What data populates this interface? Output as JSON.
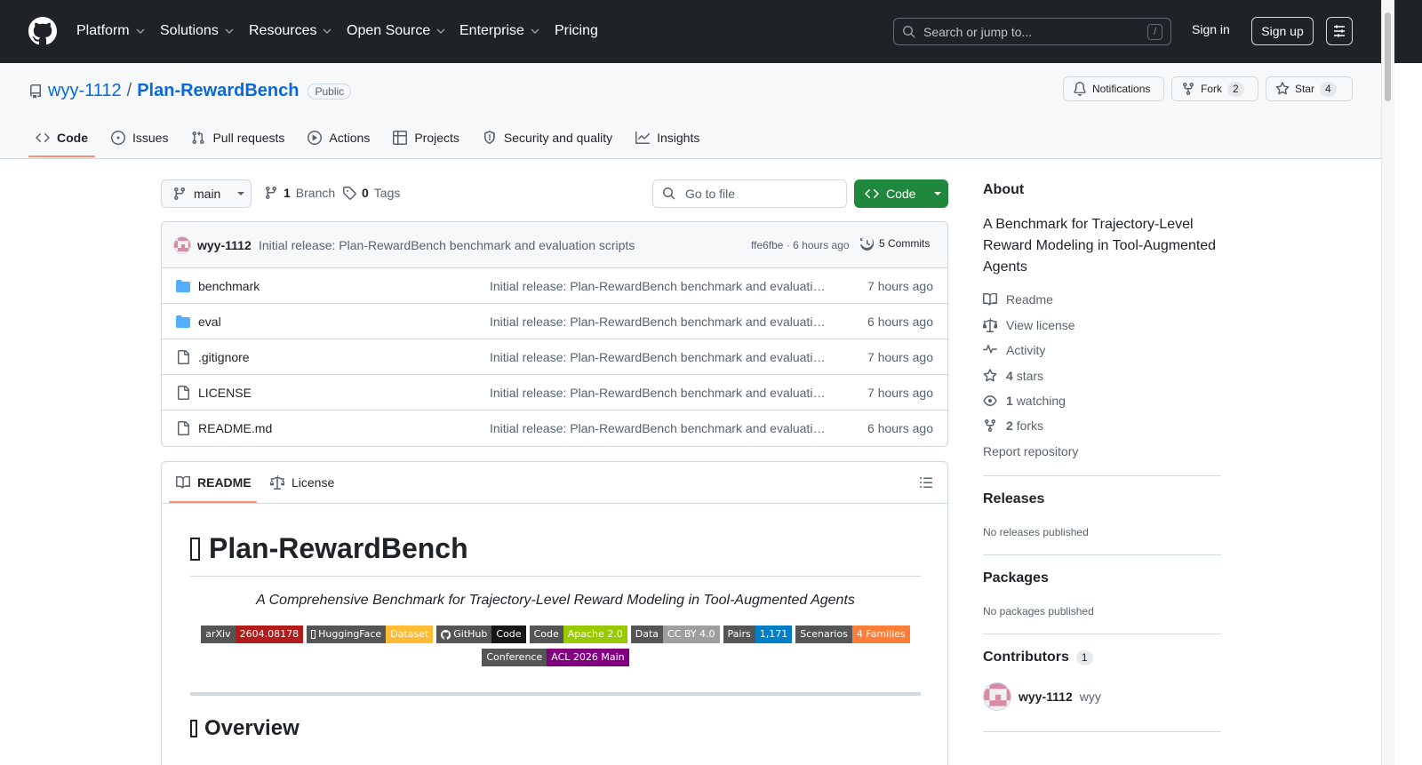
{
  "header": {
    "nav": [
      "Platform",
      "Solutions",
      "Resources",
      "Open Source",
      "Enterprise",
      "Pricing"
    ],
    "search_placeholder": "Search or jump to...",
    "search_key": "/",
    "signin": "Sign in",
    "signup": "Sign up"
  },
  "repo": {
    "owner": "wyy-1112",
    "separator": "/",
    "name": "Plan-RewardBench",
    "visibility": "Public",
    "notifications_label": "Notifications",
    "fork_label": "Fork",
    "fork_count": "2",
    "star_label": "Star",
    "star_count": "4"
  },
  "tabs": [
    "Code",
    "Issues",
    "Pull requests",
    "Actions",
    "Projects",
    "Security and quality",
    "Insights"
  ],
  "file_nav": {
    "branch": "main",
    "branch_count": "1",
    "branch_label": "Branch",
    "tag_count": "0",
    "tag_label": "Tags",
    "goto_placeholder": "Go to file",
    "code_button": "Code"
  },
  "latest_commit": {
    "author": "wyy-1112",
    "message": "Initial release: Plan-RewardBench benchmark and evaluation scripts",
    "hash": "ffe6fbe",
    "time_sep": "·",
    "time": "6 hours ago",
    "commits": "5 Commits"
  },
  "files": [
    {
      "name": "benchmark",
      "type": "dir",
      "message": "Initial release: Plan-RewardBench benchmark and evaluatio…",
      "time": "7 hours ago"
    },
    {
      "name": "eval",
      "type": "dir",
      "message": "Initial release: Plan-RewardBench benchmark and evaluatio…",
      "time": "6 hours ago"
    },
    {
      "name": ".gitignore",
      "type": "file",
      "message": "Initial release: Plan-RewardBench benchmark and evaluatio…",
      "time": "7 hours ago"
    },
    {
      "name": "LICENSE",
      "type": "file",
      "message": "Initial release: Plan-RewardBench benchmark and evaluatio…",
      "time": "7 hours ago"
    },
    {
      "name": "README.md",
      "type": "file",
      "message": "Initial release: Plan-RewardBench benchmark and evaluatio…",
      "time": "6 hours ago"
    }
  ],
  "readme": {
    "tab_readme": "README",
    "tab_license": "License",
    "h1": "Plan-RewardBench",
    "subtitle": "A Comprehensive Benchmark for Trajectory-Level Reward Modeling in Tool-Augmented Agents",
    "badges": [
      {
        "left": "arXiv",
        "right": "2604.08178",
        "color": "#b31b1b",
        "icon": ""
      },
      {
        "left": "HuggingFace",
        "right": "Dataset",
        "color": "#ffbb33",
        "icon": "hf-box"
      },
      {
        "left": "GitHub",
        "right": "Code",
        "color": "#181717",
        "icon": "github"
      },
      {
        "left": "Code",
        "right": "Apache 2.0",
        "color": "#97ca00",
        "icon": ""
      },
      {
        "left": "Data",
        "right": "CC BY 4.0",
        "color": "#9f9f9f",
        "icon": ""
      },
      {
        "left": "Pairs",
        "right": "1,171",
        "color": "#007ec6",
        "icon": ""
      },
      {
        "left": "Scenarios",
        "right": "4 Families",
        "color": "#fe7d37",
        "icon": ""
      },
      {
        "left": "Conference",
        "right": "ACL 2026 Main",
        "color": "#800080",
        "icon": ""
      }
    ],
    "h2": "Overview"
  },
  "sidebar": {
    "about_title": "About",
    "about_desc": "A Benchmark for Trajectory-Level Reward Modeling in Tool-Augmented Agents",
    "readme": "Readme",
    "license": "View license",
    "activity": "Activity",
    "stars_count": "4",
    "stars_label": "stars",
    "watching_count": "1",
    "watching_label": "watching",
    "forks_count": "2",
    "forks_label": "forks",
    "report": "Report repository",
    "releases_title": "Releases",
    "releases_text": "No releases published",
    "packages_title": "Packages",
    "packages_text": "No packages published",
    "contributors_title": "Contributors",
    "contributors_count": "1",
    "contributor_login": "wyy-1112",
    "contributor_name": "wyy"
  },
  "colors": {
    "header_bg": "#1f2328",
    "link": "#0969da",
    "primary_button": "#1f883d",
    "tab_underline": "#fd8c73",
    "folder": "#54aeff"
  }
}
